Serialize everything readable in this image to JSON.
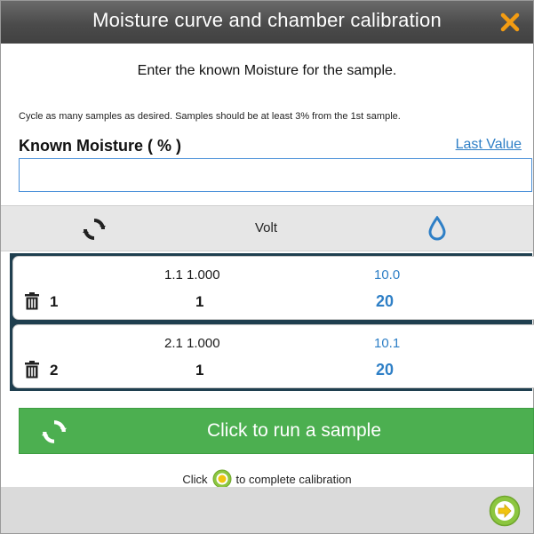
{
  "dialog": {
    "title": "Moisture curve and chamber calibration",
    "instruction": "Enter the known Moisture for the sample.",
    "note": "Cycle as many samples as desired. Samples should be at least 3% from the 1st sample.",
    "known_moisture_label": "Known  Moisture  ( % )",
    "last_value_link": "Last Value",
    "known_moisture_value": ""
  },
  "table_header": {
    "cycle_icon": "cycle-icon",
    "volt_label": "Volt",
    "drop_icon": "water-drop-icon"
  },
  "samples": [
    {
      "raw": "1.1 1.000",
      "percent": "10.0",
      "ref": "20",
      "num": "1",
      "count": "1",
      "known": "20"
    },
    {
      "raw": "2.1 1.000",
      "percent": "10.1",
      "ref": "20",
      "num": "2",
      "count": "1",
      "known": "20"
    }
  ],
  "run_button": {
    "label": "Click to run a sample"
  },
  "hint": {
    "before": "Click",
    "after": "to complete calibration"
  },
  "colors": {
    "accent_blue": "#2e7fc6",
    "run_green": "#4caf50",
    "close_orange": "#f39c12",
    "next_green": "#8cc63f"
  }
}
